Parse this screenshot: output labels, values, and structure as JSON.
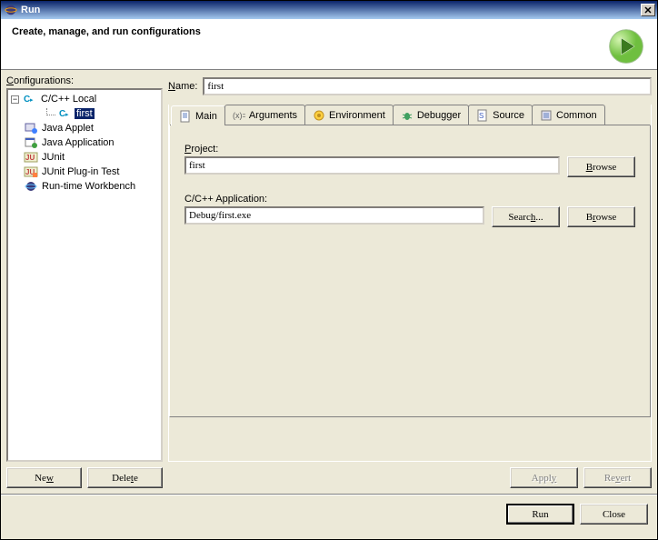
{
  "window": {
    "title": "Run"
  },
  "header": {
    "text": "Create, manage, and run configurations"
  },
  "left": {
    "label": "Configurations:",
    "tree": [
      {
        "label": "C/C++ Local",
        "icon": "c-cyan",
        "expanded": true,
        "children": [
          {
            "label": "first",
            "icon": "c-cyan",
            "selected": true
          }
        ]
      },
      {
        "label": "Java Applet",
        "icon": "applet"
      },
      {
        "label": "Java Application",
        "icon": "java-app"
      },
      {
        "label": "JUnit",
        "icon": "junit"
      },
      {
        "label": "JUnit Plug-in Test",
        "icon": "junit-plugin"
      },
      {
        "label": "Run-time Workbench",
        "icon": "workbench"
      }
    ],
    "buttons": {
      "new": "New",
      "delete": "Delete"
    }
  },
  "right": {
    "name_label": "Name:",
    "name_value": "first",
    "tabs": [
      "Main",
      "Arguments",
      "Environment",
      "Debugger",
      "Source",
      "Common"
    ],
    "active_tab": 0,
    "main_tab": {
      "project_label": "Project:",
      "project_value": "first",
      "app_label": "C/C++ Application:",
      "app_value": "Debug/first.exe",
      "browse": "Browse",
      "search": "Search..."
    },
    "apply": "Apply",
    "revert": "Revert"
  },
  "footer": {
    "run": "Run",
    "close": "Close"
  }
}
